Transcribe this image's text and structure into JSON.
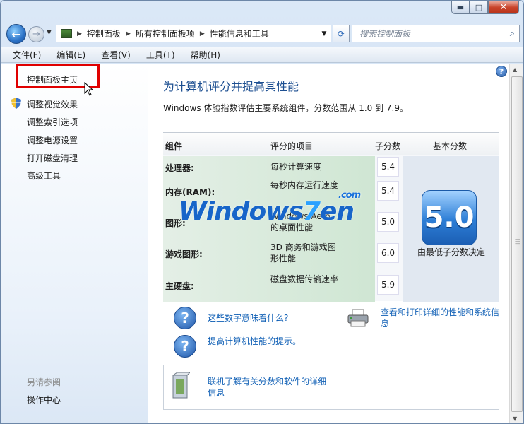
{
  "window": {
    "caption_buttons": {
      "minimize": "▬",
      "maximize": "□",
      "close": "✕"
    }
  },
  "nav": {
    "breadcrumbs": [
      "控制面板",
      "所有控制面板项",
      "性能信息和工具"
    ],
    "search_placeholder": "搜索控制面板"
  },
  "menu": [
    "文件(F)",
    "编辑(E)",
    "查看(V)",
    "工具(T)",
    "帮助(H)"
  ],
  "sidebar": {
    "home": "控制面板主页",
    "items": [
      "调整视觉效果",
      "调整索引选项",
      "调整电源设置",
      "打开磁盘清理",
      "高级工具"
    ],
    "see_also_label": "另请参阅",
    "see_also_items": [
      "操作中心"
    ]
  },
  "main": {
    "title": "为计算机评分并提高其性能",
    "subtitle": "Windows 体验指数评估主要系统组件，分数范围从 1.0 到 7.9。",
    "table": {
      "headers": [
        "组件",
        "评分的项目",
        "子分数",
        "基本分数"
      ],
      "rows": [
        {
          "component": "处理器:",
          "item": "每秒计算速度",
          "score": "5.4"
        },
        {
          "component": "内存(RAM):",
          "item": "每秒内存运行速度",
          "score": "5.4"
        },
        {
          "component": "图形:",
          "item": "Windows Aero 的桌面性能",
          "score": "5.0"
        },
        {
          "component": "游戏图形:",
          "item": "3D 商务和游戏图形性能",
          "score": "6.0"
        },
        {
          "component": "主硬盘:",
          "item": "磁盘数据传输速率",
          "score": "5.9"
        }
      ],
      "base_score": "5.0",
      "base_caption": "由最低子分数决定"
    },
    "watermark": {
      "text": "Windows",
      "seven": "7",
      "suffix": "en",
      "com": ".com"
    },
    "links": {
      "what_mean": "这些数字意味着什么?",
      "tips": "提高计算机性能的提示。",
      "print": "查看和打印详细的性能和系统信息",
      "online": "联机了解有关分数和软件的详细信息"
    }
  },
  "colors": {
    "accent": "#1d4f91",
    "link": "#0f5fb5",
    "highlight": "#e00000"
  }
}
